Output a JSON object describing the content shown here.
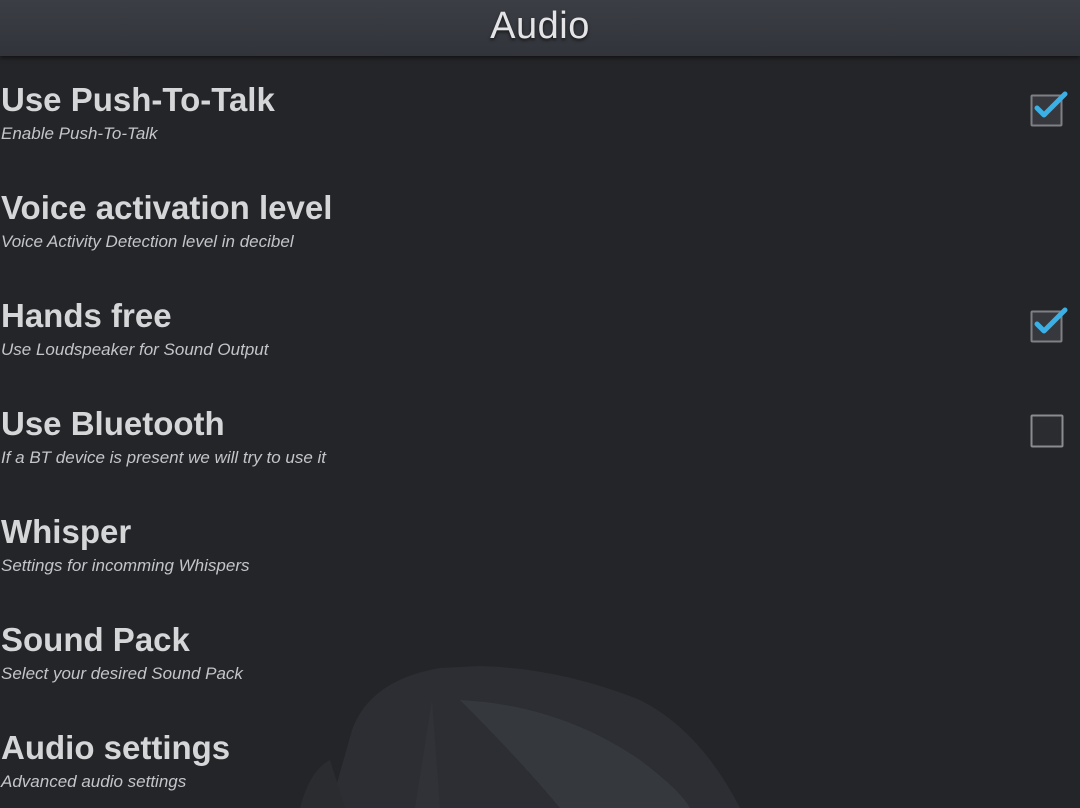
{
  "header": {
    "title": "Audio"
  },
  "preferences": [
    {
      "title": "Use Push-To-Talk",
      "summary": "Enable Push-To-Talk",
      "has_checkbox": true,
      "checked": true
    },
    {
      "title": "Voice activation level",
      "summary": "Voice Activity Detection level in decibel",
      "has_checkbox": false
    },
    {
      "title": "Hands free",
      "summary": "Use Loudspeaker for Sound Output",
      "has_checkbox": true,
      "checked": true
    },
    {
      "title": "Use Bluetooth",
      "summary": "If a BT device is present we will try to use it",
      "has_checkbox": true,
      "checked": false
    },
    {
      "title": "Whisper",
      "summary": "Settings for incomming Whispers",
      "has_checkbox": false
    },
    {
      "title": "Sound Pack",
      "summary": "Select your desired Sound Pack",
      "has_checkbox": false
    },
    {
      "title": "Audio settings",
      "summary": "Advanced audio settings",
      "has_checkbox": false
    }
  ],
  "colors": {
    "background": "#242528",
    "header": "#35383e",
    "title_text": "#d5d6d8",
    "summary_text": "#c4c5c8",
    "check_accent": "#3ab0e6",
    "checkbox_border": "#8a8c90"
  },
  "icons": {
    "checked": "checkbox-checked-icon",
    "unchecked": "checkbox-unchecked-icon",
    "background": "headset-watermark"
  }
}
